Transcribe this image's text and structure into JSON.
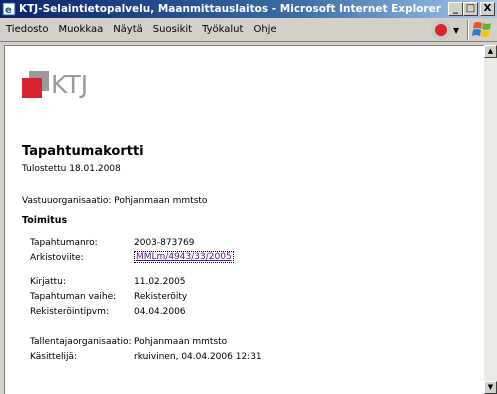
{
  "window": {
    "title": "KTJ-Selaintietopalvelu, Maanmittauslaitos - Microsoft Internet Explorer",
    "buttons": {
      "minimize": "_",
      "maximize": "□",
      "close": "X"
    }
  },
  "menu": {
    "items": [
      {
        "label": "Tiedosto"
      },
      {
        "label": "Muokkaa"
      },
      {
        "label": "Näytä"
      },
      {
        "label": "Suosikit"
      },
      {
        "label": "Työkalut"
      },
      {
        "label": "Ohje"
      }
    ],
    "dropdown_arrow": "▼"
  },
  "scrollbar": {
    "up": "▲",
    "down": "▼"
  },
  "page": {
    "logo_text": "KTJ",
    "title": "Tapahtumakortti",
    "printed": "Tulostettu 18.01.2008",
    "responsible_org": "Vastuuorganisaatio: Pohjanmaan mmtsto",
    "section": "Toimitus",
    "fields": [
      {
        "label": "Tapahtumanro:",
        "value": "2003-873769"
      },
      {
        "label": "Arkistoviite:",
        "value": "MMLm/4943/33/2005"
      },
      {
        "label": "Kirjattu:",
        "value": "11.02.2005"
      },
      {
        "label": "Tapahtuman vaihe:",
        "value": "Rekisteröity"
      },
      {
        "label": "Rekisteröintipvm:",
        "value": "04.04.2006"
      },
      {
        "label": "Tallentajaorganisaatio:",
        "value": "Pohjanmaan mmtsto"
      },
      {
        "label": "Käsittelijä:",
        "value": "rkuivinen, 04.04.2006  12:31"
      }
    ]
  },
  "colors": {
    "logo_red": "#d8232a",
    "logo_gray": "#9a9a9a",
    "titlebar": "#0a246a"
  }
}
